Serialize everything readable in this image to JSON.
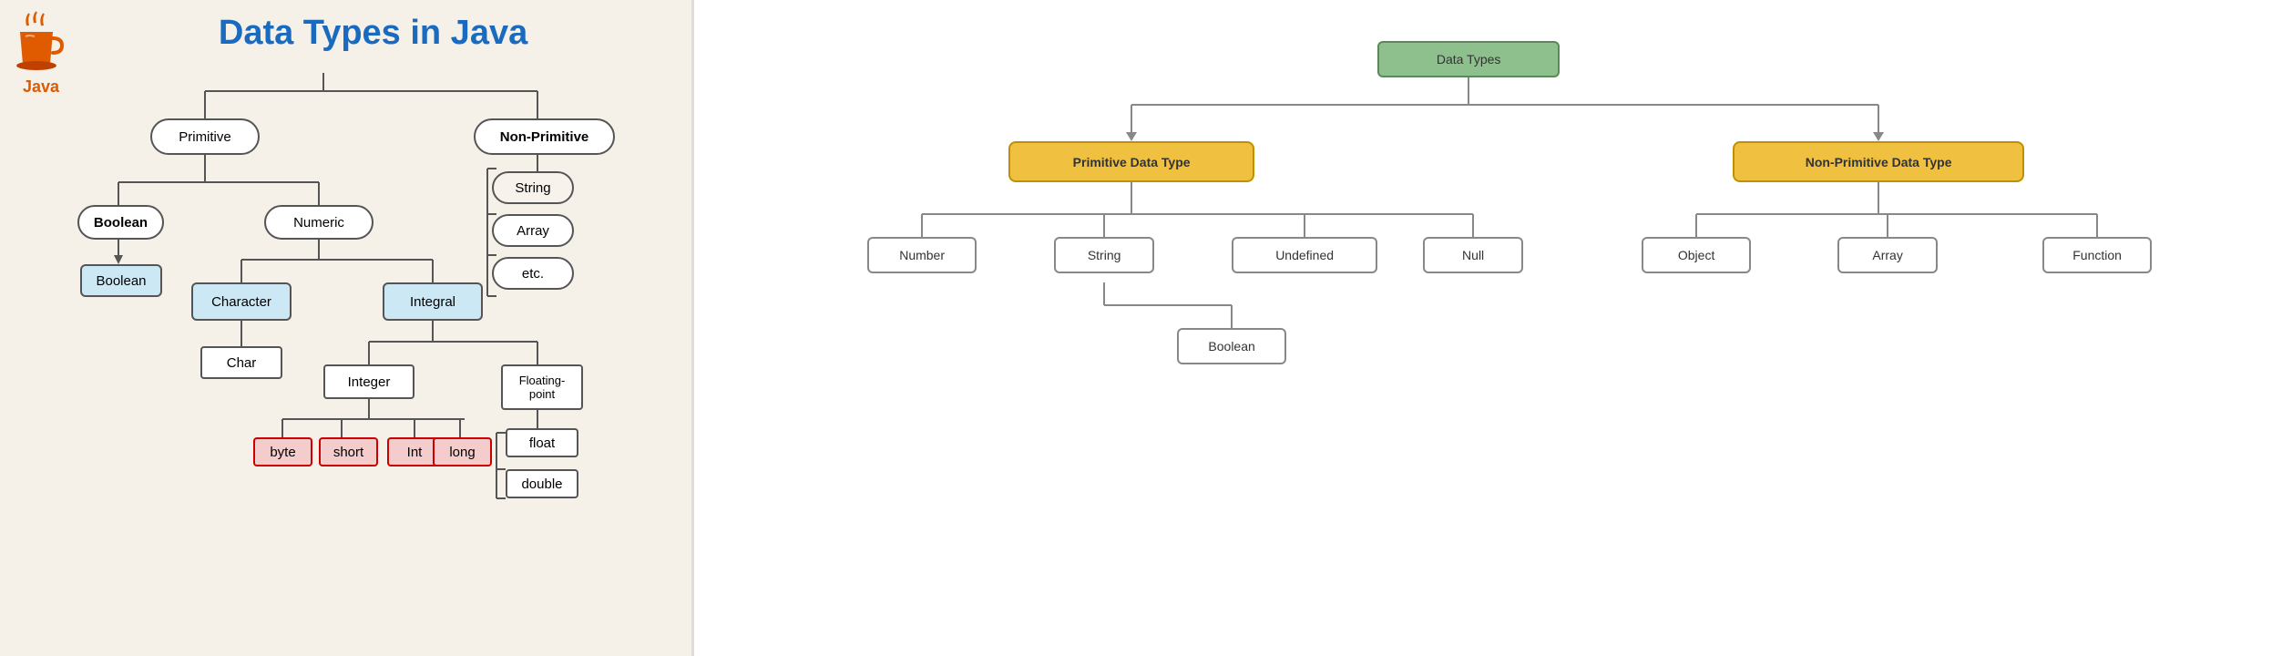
{
  "left": {
    "title": "Data Types in Java",
    "java_label": "Java",
    "nodes": {
      "primitive": "Primitive",
      "non_primitive": "Non-Primitive",
      "boolean_label": "Boolean",
      "boolean_val": "Boolean",
      "numeric": "Numeric",
      "character": "Character",
      "char": "Char",
      "integral": "Integral",
      "integer": "Integer",
      "floating": "Floating-\npoint",
      "byte": "byte",
      "short": "short",
      "int": "Int",
      "long": "long",
      "float": "float",
      "double": "double",
      "string": "String",
      "array": "Array",
      "etc": "etc."
    }
  },
  "right": {
    "nodes": {
      "data_types": "Data Types",
      "primitive_dt": "Primitive Data Type",
      "non_primitive_dt": "Non-Primitive Data Type",
      "number": "Number",
      "string": "String",
      "undefined": "Undefined",
      "null": "Null",
      "object": "Object",
      "array": "Array",
      "function": "Function",
      "boolean": "Boolean"
    }
  }
}
